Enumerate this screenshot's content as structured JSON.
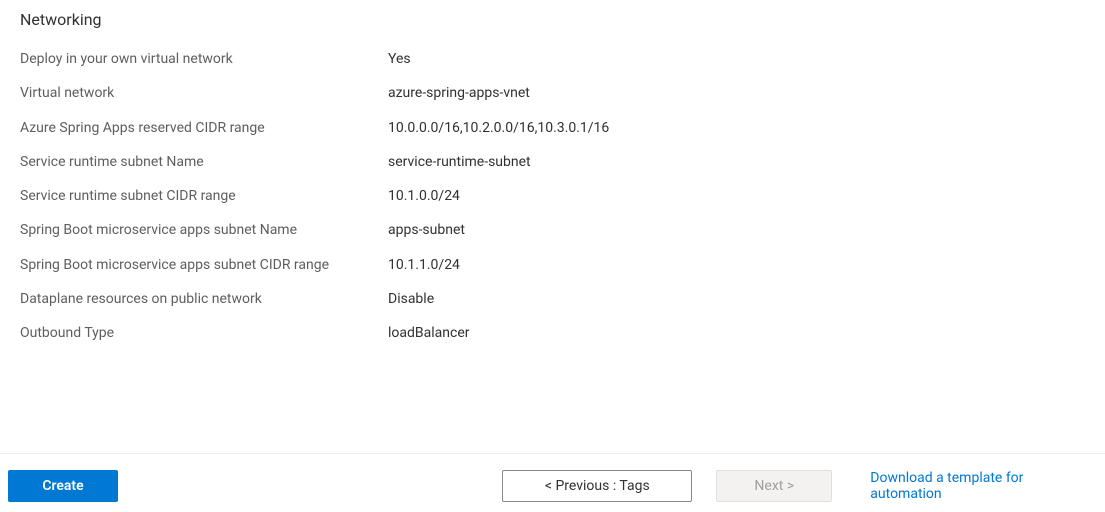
{
  "section": {
    "title": "Networking"
  },
  "fields": {
    "deploy_vnet": {
      "label": "Deploy in your own virtual network",
      "value": "Yes"
    },
    "vnet": {
      "label": "Virtual network",
      "value": "azure-spring-apps-vnet"
    },
    "cidr_range": {
      "label": "Azure Spring Apps reserved CIDR range",
      "value": "10.0.0.0/16,10.2.0.0/16,10.3.0.1/16"
    },
    "runtime_subnet_name": {
      "label": "Service runtime subnet Name",
      "value": "service-runtime-subnet"
    },
    "runtime_subnet_cidr": {
      "label": "Service runtime subnet CIDR range",
      "value": "10.1.0.0/24"
    },
    "apps_subnet_name": {
      "label": "Spring Boot microservice apps subnet Name",
      "value": "apps-subnet"
    },
    "apps_subnet_cidr": {
      "label": "Spring Boot microservice apps subnet CIDR range",
      "value": "10.1.1.0/24"
    },
    "dataplane_public": {
      "label": "Dataplane resources on public network",
      "value": "Disable"
    },
    "outbound_type": {
      "label": "Outbound Type",
      "value": "loadBalancer"
    }
  },
  "footer": {
    "create_label": "Create",
    "previous_label": "< Previous : Tags",
    "next_label": "Next >",
    "download_label": "Download a template for automation"
  }
}
